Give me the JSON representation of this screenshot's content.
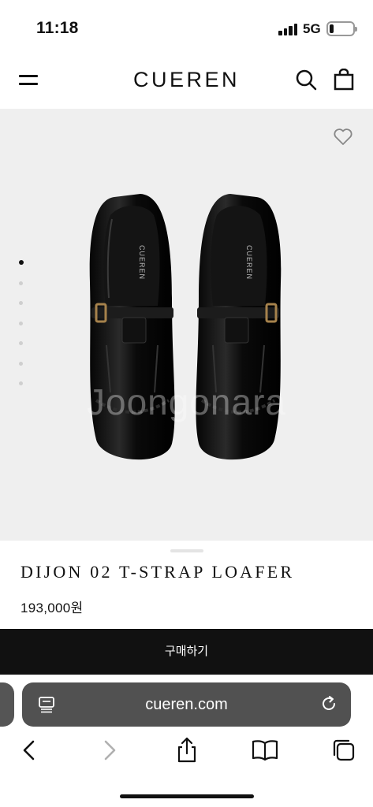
{
  "status_bar": {
    "time": "11:18",
    "network": "5G"
  },
  "header": {
    "logo": "CUEREN",
    "icons": [
      "menu-icon",
      "search-icon",
      "shopping-bag-icon"
    ]
  },
  "gallery": {
    "image": "black-patent-t-strap-loafers",
    "watermark": "Joongonara",
    "slide_count": 7,
    "active_slide": 1,
    "wishlist_icon": "heart-icon"
  },
  "product": {
    "name": "DIJON 02 T-STRAP LOAFER",
    "price": "193,000원"
  },
  "buy_button": {
    "label": "구매하기"
  },
  "browser": {
    "url": "cueren.com",
    "toolbar_icons": [
      "back-icon",
      "forward-icon",
      "share-icon",
      "bookmarks-icon",
      "tabs-icon"
    ]
  },
  "colors": {
    "accent": "#111111",
    "gallery_bg": "#efefef",
    "url_bar": "#515151"
  }
}
